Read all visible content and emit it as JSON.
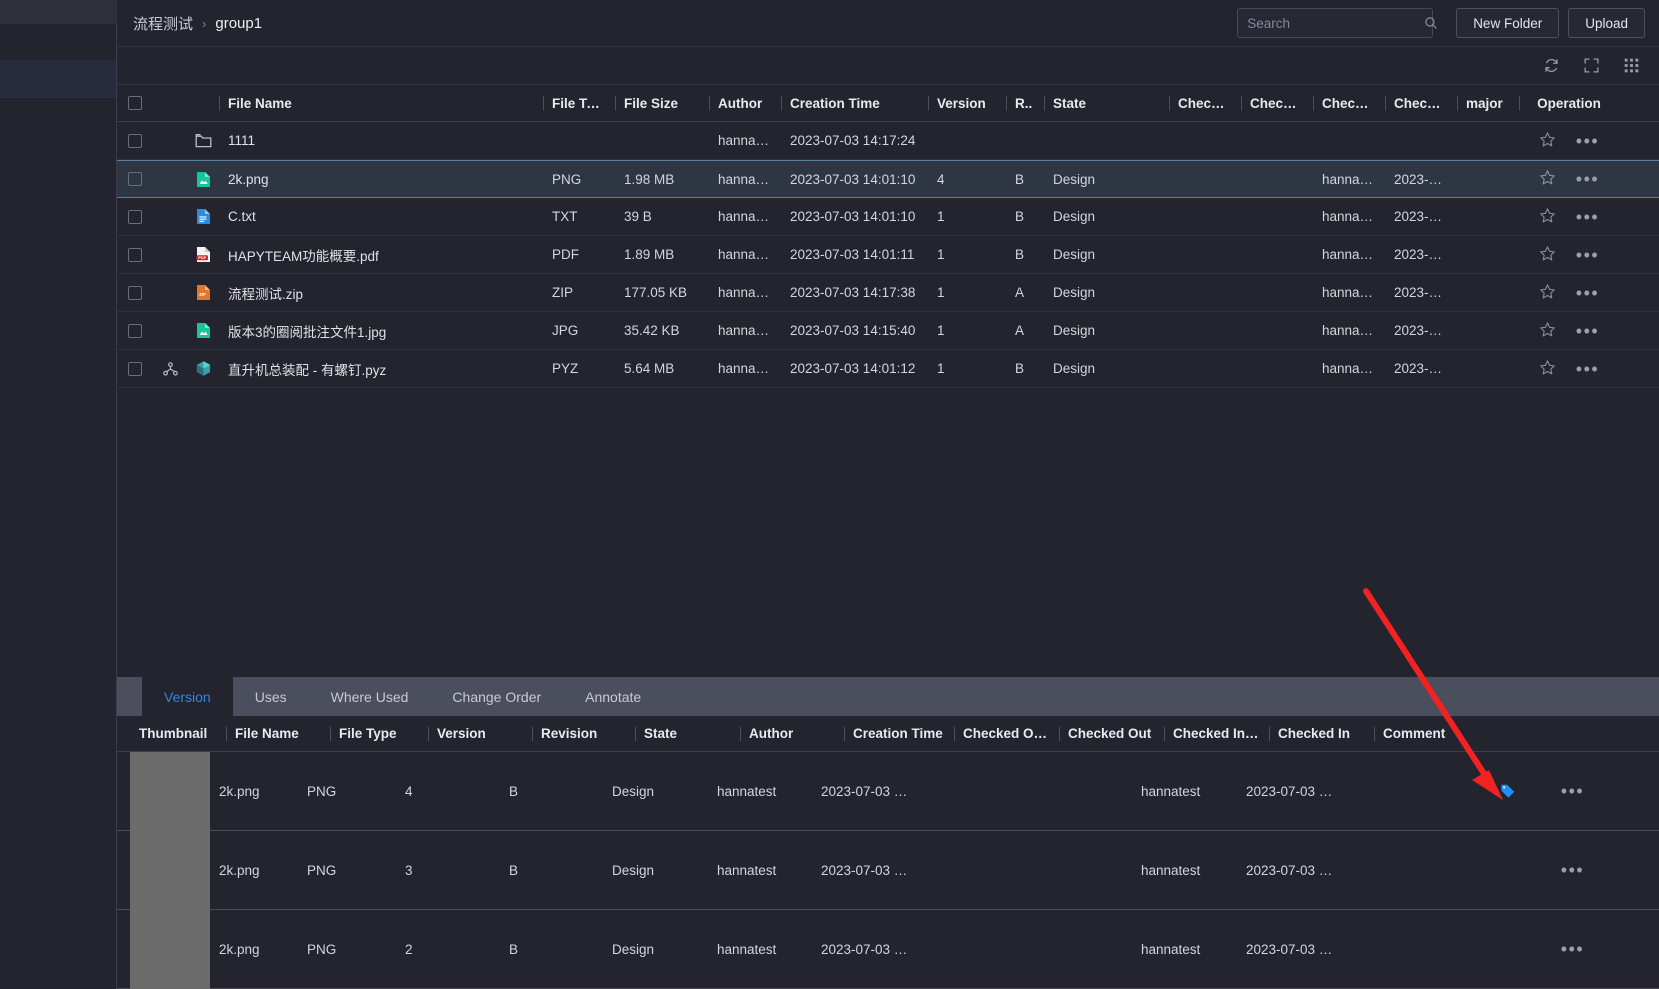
{
  "breadcrumb": {
    "root": "流程测试",
    "separator": "›",
    "current": "group1"
  },
  "search": {
    "placeholder": "Search",
    "value": "",
    "icon": "search-icon"
  },
  "toolbar": {
    "new_folder_label": "New Folder",
    "upload_label": "Upload",
    "refresh_icon": "refresh-icon",
    "fullscreen_icon": "fullscreen-icon",
    "grid_icon": "grid-view-icon"
  },
  "file_table": {
    "columns": {
      "file_name": "File Name",
      "file_type": "File Type",
      "file_size": "File Size",
      "author": "Author",
      "creation_time": "Creation Time",
      "version": "Version",
      "revision": "R..",
      "state": "State",
      "checked_out_by": "Checke…",
      "checked_out": "Checke…",
      "checked_in_by": "Checke…",
      "checked_in": "Checke…",
      "major": "major",
      "operation": "Operation"
    },
    "rows": [
      {
        "icon": "folder-icon",
        "name": "1111",
        "type": "",
        "size": "",
        "author": "hannatest",
        "created": "2023-07-03 14:17:24",
        "version": "",
        "revision": "",
        "state": "",
        "co_by": "",
        "co": "",
        "ci_by": "",
        "ci": "",
        "major": "",
        "selected": false,
        "has_tree": false
      },
      {
        "icon": "image-file-icon",
        "name": "2k.png",
        "type": "PNG",
        "size": "1.98 MB",
        "author": "hannatest",
        "created": "2023-07-03 14:01:10",
        "version": "4",
        "revision": "B",
        "state": "Design",
        "co_by": "",
        "co": "",
        "ci_by": "hannatest",
        "ci": "2023-0…",
        "major": "",
        "selected": true,
        "has_tree": false
      },
      {
        "icon": "text-file-icon",
        "name": "C.txt",
        "type": "TXT",
        "size": "39 B",
        "author": "hannatest",
        "created": "2023-07-03 14:01:10",
        "version": "1",
        "revision": "B",
        "state": "Design",
        "co_by": "",
        "co": "",
        "ci_by": "hannatest",
        "ci": "2023-0…",
        "major": "",
        "selected": false,
        "has_tree": false
      },
      {
        "icon": "pdf-file-icon",
        "name": "HAPYTEAM功能概要.pdf",
        "type": "PDF",
        "size": "1.89 MB",
        "author": "hannatest",
        "created": "2023-07-03 14:01:11",
        "version": "1",
        "revision": "B",
        "state": "Design",
        "co_by": "",
        "co": "",
        "ci_by": "hannatest",
        "ci": "2023-0…",
        "major": "",
        "selected": false,
        "has_tree": false
      },
      {
        "icon": "zip-file-icon",
        "name": "流程测试.zip",
        "type": "ZIP",
        "size": "177.05 KB",
        "author": "hannatest",
        "created": "2023-07-03 14:17:38",
        "version": "1",
        "revision": "A",
        "state": "Design",
        "co_by": "",
        "co": "",
        "ci_by": "hannatest",
        "ci": "2023-0…",
        "major": "",
        "selected": false,
        "has_tree": false
      },
      {
        "icon": "image-file-icon",
        "name": "版本3的圈阅批注文件1.jpg",
        "type": "JPG",
        "size": "35.42 KB",
        "author": "hannatest",
        "created": "2023-07-03 14:15:40",
        "version": "1",
        "revision": "A",
        "state": "Design",
        "co_by": "",
        "co": "",
        "ci_by": "hannatest",
        "ci": "2023-0…",
        "major": "",
        "selected": false,
        "has_tree": false
      },
      {
        "icon": "cad-file-icon",
        "name": "直升机总装配 - 有螺钉.pyz",
        "type": "PYZ",
        "size": "5.64 MB",
        "author": "hannatest",
        "created": "2023-07-03 14:01:12",
        "version": "1",
        "revision": "B",
        "state": "Design",
        "co_by": "",
        "co": "",
        "ci_by": "hannatest",
        "ci": "2023-0…",
        "major": "",
        "selected": false,
        "has_tree": true
      }
    ],
    "row_star_icon": "star-icon",
    "row_more_icon": "more-options-icon"
  },
  "detail_panel": {
    "tabs": [
      {
        "label": "Version",
        "active": true
      },
      {
        "label": "Uses",
        "active": false
      },
      {
        "label": "Where Used",
        "active": false
      },
      {
        "label": "Change Order",
        "active": false
      },
      {
        "label": "Annotate",
        "active": false
      }
    ],
    "columns": {
      "thumbnail": "Thumbnail",
      "file_name": "File Name",
      "file_type": "File Type",
      "version": "Version",
      "revision": "Revision",
      "state": "State",
      "author": "Author",
      "creation_time": "Creation Time",
      "checked_out_by": "Checked O…",
      "checked_out": "Checked Out",
      "checked_in_by": "Checked In …",
      "checked_in": "Checked In",
      "comment": "Comment"
    },
    "rows": [
      {
        "name": "2k.png",
        "type": "PNG",
        "version": "4",
        "revision": "B",
        "state": "Design",
        "author": "hannatest",
        "created": "2023-07-03 …",
        "co_by": "",
        "co": "",
        "ci_by": "hannatest",
        "ci": "2023-07-03 …",
        "comment": "",
        "has_tag": true
      },
      {
        "name": "2k.png",
        "type": "PNG",
        "version": "3",
        "revision": "B",
        "state": "Design",
        "author": "hannatest",
        "created": "2023-07-03 …",
        "co_by": "",
        "co": "",
        "ci_by": "hannatest",
        "ci": "2023-07-03 …",
        "comment": "",
        "has_tag": false
      },
      {
        "name": "2k.png",
        "type": "PNG",
        "version": "2",
        "revision": "B",
        "state": "Design",
        "author": "hannatest",
        "created": "2023-07-03 …",
        "co_by": "",
        "co": "",
        "ci_by": "hannatest",
        "ci": "2023-07-03 …",
        "comment": "",
        "has_tag": false
      }
    ],
    "tag_icon": "tag-icon",
    "row_more_icon": "more-options-icon"
  },
  "annotation": {
    "arrow_color": "#f22222",
    "arrow_name": "red-pointer-arrow"
  },
  "colors": {
    "accent": "#2f86e0",
    "selected_row": "#2e3644",
    "background": "#23242e",
    "tag_blue": "#1e90ff"
  }
}
